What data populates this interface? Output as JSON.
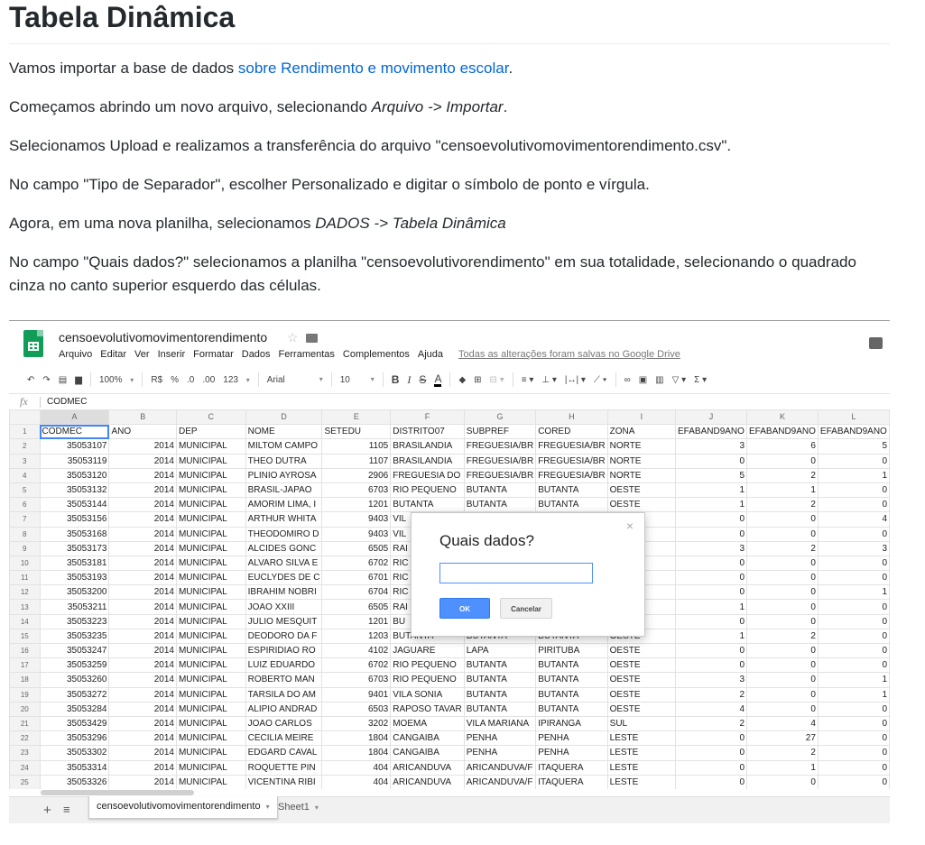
{
  "doc": {
    "title": "Tabela Dinâmica",
    "p1_before": "Vamos importar a base de dados ",
    "p1_link": "sobre Rendimento e movimento escolar",
    "p1_after": ".",
    "p2_before": "Começamos abrindo um novo arquivo, selecionando ",
    "p2_em": "Arquivo -> Importar",
    "p2_after": ".",
    "p3": "Selecionamos Upload e realizamos a transferência do arquivo \"censoevolutivomovimentorendimento.csv\".",
    "p4": "No campo \"Tipo de Separador\", escolher Personalizado e digitar o símbolo de ponto e vírgula.",
    "p5_before": "Agora, em uma nova planilha, selecionamos ",
    "p5_em": "DADOS -> Tabela Dinâmica",
    "p6": "No campo \"Quais dados?\" selecionamos a planilha \"censoevolutivorendimento\" em sua totalidade, selecionando o quadrado cinza no canto superior esquerdo das células."
  },
  "sheet": {
    "file_title": "censoevolutivomovimentorendimento",
    "title_star": "☆",
    "menu": [
      "Arquivo",
      "Editar",
      "Ver",
      "Inserir",
      "Formatar",
      "Dados",
      "Ferramentas",
      "Complementos",
      "Ajuda"
    ],
    "saved_status": "Todas as alterações foram salvas no Google Drive",
    "toolbar": {
      "zoom": "100%",
      "currency": "R$",
      "percent": "%",
      "dec_less": ".0",
      "dec_more": ".00",
      "format_more": "123",
      "font": "Arial",
      "font_size": "10",
      "bold": "B",
      "italic": "I",
      "strike": "S",
      "text_color": "A"
    },
    "fx_label": "fx",
    "formula_value": "CODMEC",
    "columns": [
      "A",
      "B",
      "C",
      "D",
      "E",
      "F",
      "G",
      "H",
      "I",
      "J",
      "K",
      "L"
    ],
    "rows": [
      [
        "CODMEC",
        "ANO",
        "DEP",
        "NOME",
        "SETEDU",
        "DISTRITO07",
        "SUBPREF",
        "CORED",
        "ZONA",
        "EFABAND9ANO",
        "EFABAND9ANO",
        "EFABAND9ANO"
      ],
      [
        "35053107",
        "2014",
        "MUNICIPAL",
        "MILTOM CAMPO",
        "1105",
        "BRASILANDIA",
        "FREGUESIA/BR",
        "FREGUESIA/BR",
        "NORTE",
        "3",
        "6",
        "5"
      ],
      [
        "35053119",
        "2014",
        "MUNICIPAL",
        "THEO DUTRA",
        "1107",
        "BRASILANDIA",
        "FREGUESIA/BR",
        "FREGUESIA/BR",
        "NORTE",
        "0",
        "0",
        "0"
      ],
      [
        "35053120",
        "2014",
        "MUNICIPAL",
        "PLINIO AYROSA",
        "2906",
        "FREGUESIA DO",
        "FREGUESIA/BR",
        "FREGUESIA/BR",
        "NORTE",
        "5",
        "2",
        "1"
      ],
      [
        "35053132",
        "2014",
        "MUNICIPAL",
        "BRASIL-JAPAO",
        "6703",
        "RIO PEQUENO",
        "BUTANTA",
        "BUTANTA",
        "OESTE",
        "1",
        "1",
        "0"
      ],
      [
        "35053144",
        "2014",
        "MUNICIPAL",
        "AMORIM LIMA, I",
        "1201",
        "BUTANTA",
        "BUTANTA",
        "BUTANTA",
        "OESTE",
        "1",
        "2",
        "0"
      ],
      [
        "35053156",
        "2014",
        "MUNICIPAL",
        "ARTHUR WHITA",
        "9403",
        "VIL",
        "",
        "",
        "",
        "0",
        "0",
        "4"
      ],
      [
        "35053168",
        "2014",
        "MUNICIPAL",
        "THEODOMIRO D",
        "9403",
        "VIL",
        "",
        "",
        "",
        "0",
        "0",
        "0"
      ],
      [
        "35053173",
        "2014",
        "MUNICIPAL",
        "ALCIDES GONC",
        "6505",
        "RAI",
        "",
        "",
        "",
        "3",
        "2",
        "3"
      ],
      [
        "35053181",
        "2014",
        "MUNICIPAL",
        "ALVARO SILVA E",
        "6702",
        "RIC",
        "",
        "",
        "",
        "0",
        "0",
        "0"
      ],
      [
        "35053193",
        "2014",
        "MUNICIPAL",
        "EUCLYDES DE C",
        "6701",
        "RIC",
        "",
        "",
        "",
        "0",
        "0",
        "0"
      ],
      [
        "35053200",
        "2014",
        "MUNICIPAL",
        "IBRAHIM NOBRI",
        "6704",
        "RIC",
        "",
        "",
        "",
        "0",
        "0",
        "1"
      ],
      [
        "35053211",
        "2014",
        "MUNICIPAL",
        "JOAO XXIII",
        "6505",
        "RAI",
        "",
        "",
        "",
        "1",
        "0",
        "0"
      ],
      [
        "35053223",
        "2014",
        "MUNICIPAL",
        "JULIO MESQUIT",
        "1201",
        "BU",
        "",
        "",
        "",
        "0",
        "0",
        "0"
      ],
      [
        "35053235",
        "2014",
        "MUNICIPAL",
        "DEODORO DA F",
        "1203",
        "BUTANTA",
        "BUTANTA",
        "BUTANTA",
        "OESTE",
        "1",
        "2",
        "0"
      ],
      [
        "35053247",
        "2014",
        "MUNICIPAL",
        "ESPIRIDIAO RO",
        "4102",
        "JAGUARE",
        "LAPA",
        "PIRITUBA",
        "OESTE",
        "0",
        "0",
        "0"
      ],
      [
        "35053259",
        "2014",
        "MUNICIPAL",
        "LUIZ EDUARDO",
        "6702",
        "RIO PEQUENO",
        "BUTANTA",
        "BUTANTA",
        "OESTE",
        "0",
        "0",
        "0"
      ],
      [
        "35053260",
        "2014",
        "MUNICIPAL",
        "ROBERTO MAN",
        "6703",
        "RIO PEQUENO",
        "BUTANTA",
        "BUTANTA",
        "OESTE",
        "3",
        "0",
        "1"
      ],
      [
        "35053272",
        "2014",
        "MUNICIPAL",
        "TARSILA DO AM",
        "9401",
        "VILA SONIA",
        "BUTANTA",
        "BUTANTA",
        "OESTE",
        "2",
        "0",
        "1"
      ],
      [
        "35053284",
        "2014",
        "MUNICIPAL",
        "ALIPIO ANDRAD",
        "6503",
        "RAPOSO TAVAR",
        "BUTANTA",
        "BUTANTA",
        "OESTE",
        "4",
        "0",
        "0"
      ],
      [
        "35053429",
        "2014",
        "MUNICIPAL",
        "JOAO CARLOS",
        "3202",
        "MOEMA",
        "VILA MARIANA",
        "IPIRANGA",
        "SUL",
        "2",
        "4",
        "0"
      ],
      [
        "35053296",
        "2014",
        "MUNICIPAL",
        "CECILIA MEIRE",
        "1804",
        "CANGAIBA",
        "PENHA",
        "PENHA",
        "LESTE",
        "0",
        "27",
        "0"
      ],
      [
        "35053302",
        "2014",
        "MUNICIPAL",
        "EDGARD CAVAL",
        "1804",
        "CANGAIBA",
        "PENHA",
        "PENHA",
        "LESTE",
        "0",
        "2",
        "0"
      ],
      [
        "35053314",
        "2014",
        "MUNICIPAL",
        "ROQUETTE PIN",
        "404",
        "ARICANDUVA",
        "ARICANDUVA/F",
        "ITAQUERA",
        "LESTE",
        "0",
        "1",
        "0"
      ],
      [
        "35053326",
        "2014",
        "MUNICIPAL",
        "VICENTINA RIBI",
        "404",
        "ARICANDUVA",
        "ARICANDUVA/F",
        "ITAQUERA",
        "LESTE",
        "0",
        "0",
        "0"
      ]
    ],
    "numeric_columns": [
      0,
      1,
      4,
      9,
      10,
      11
    ],
    "dialog": {
      "title": "Quais dados?",
      "close": "×",
      "input_value": "",
      "ok_label": "OK",
      "cancel_label": "Cancelar"
    },
    "tabs": {
      "plus": "+",
      "list": "≡",
      "active": "censoevolutivomovimentorendimento",
      "other": "Sheet1"
    }
  }
}
